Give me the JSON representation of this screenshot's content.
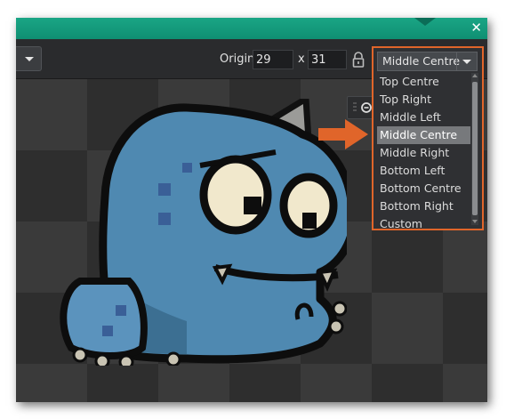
{
  "window": {
    "close_glyph": "✕"
  },
  "toolbar": {
    "origin_label": "Origin",
    "origin_x": "29",
    "separator": "x",
    "origin_y": "31"
  },
  "origin_dropdown": {
    "selected": "Middle Centre",
    "options": [
      "Top Centre",
      "Top Right",
      "Middle Left",
      "Middle Centre",
      "Middle Right",
      "Bottom Left",
      "Bottom Centre",
      "Bottom Right",
      "Custom"
    ]
  },
  "icons": {
    "lock": "lock-icon",
    "arrow": "arrow-right-icon",
    "zoom": "zoom-icon",
    "close": "close-icon"
  },
  "colors": {
    "title_teal": "#14a07f",
    "highlight_orange": "#e0652a",
    "selected_item": "#77797c",
    "sprite_blue": "#4f89b1"
  }
}
